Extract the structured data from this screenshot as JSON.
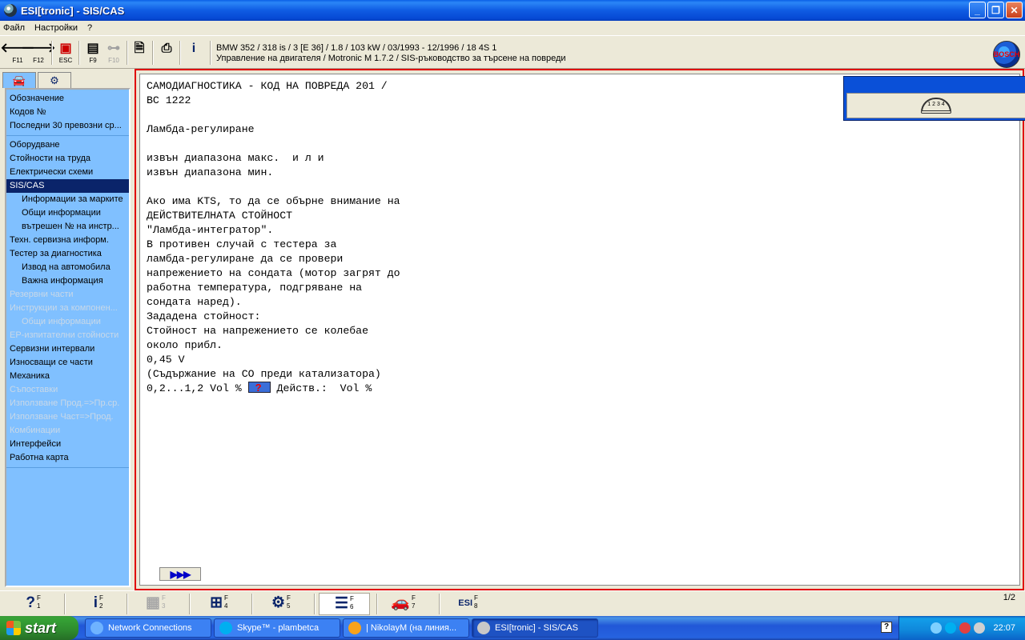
{
  "window": {
    "title": "ESI[tronic] - SIS/CAS",
    "buttons": {
      "minimize": "_",
      "maximize": "❐",
      "close": "✕"
    }
  },
  "menu": [
    "Файл",
    "Настройки",
    "?"
  ],
  "toolbar": {
    "back_key": "F11",
    "forward_key": "F12",
    "esc_key": "ESC",
    "f9_key": "F9",
    "f10_key": "F10",
    "vehicle_line1": "BMW 352 / 318 is / 3 [E 36] / 1.8 / 103 kW / 03/1993 - 12/1996 / 18 4S 1",
    "vehicle_line2": "Управление на двигателя / Motronic M 1.7.2 / SIS-ръководство за търсене на повреди",
    "logo_text": "BOSCH"
  },
  "sidebar": {
    "groups": [
      {
        "items": [
          {
            "label": "Обозначение",
            "state": "normal"
          },
          {
            "label": "Кодов №",
            "state": "normal"
          },
          {
            "label": "Последни 30 превозни ср...",
            "state": "normal"
          }
        ]
      },
      {
        "items": [
          {
            "label": "Оборудване",
            "state": "normal"
          },
          {
            "label": "Стойности на труда",
            "state": "normal"
          },
          {
            "label": "Електрически схеми",
            "state": "normal"
          },
          {
            "label": "SIS/CAS",
            "state": "active"
          },
          {
            "label": "Информации за марките",
            "state": "sub"
          },
          {
            "label": "Общи информации",
            "state": "sub"
          },
          {
            "label": "вътрешен № на инстр...",
            "state": "sub"
          },
          {
            "label": "Техн. сервизна информ.",
            "state": "normal"
          },
          {
            "label": "Тестер за диагностика",
            "state": "normal"
          },
          {
            "label": "Извод на автомобила",
            "state": "sub"
          },
          {
            "label": "Важна информация",
            "state": "sub"
          },
          {
            "label": "Резервни части",
            "state": "disabled"
          },
          {
            "label": "Инструкции за компонен...",
            "state": "disabled"
          },
          {
            "label": "Общи информации",
            "state": "sub-disabled"
          },
          {
            "label": "ЕР-изпитателни стойности",
            "state": "disabled"
          },
          {
            "label": "Сервизни интервали",
            "state": "normal"
          },
          {
            "label": "Износващи се части",
            "state": "normal"
          },
          {
            "label": "Механика",
            "state": "normal"
          },
          {
            "label": "Съпоставки",
            "state": "disabled"
          },
          {
            "label": "Използване Прод.=>Пр.ср.",
            "state": "disabled"
          },
          {
            "label": "Използване Част=>Прод.",
            "state": "disabled"
          },
          {
            "label": "Комбинации",
            "state": "disabled"
          },
          {
            "label": "Интерфейси",
            "state": "normal"
          },
          {
            "label": "Работна карта",
            "state": "normal"
          }
        ]
      }
    ]
  },
  "content": {
    "lines": [
      "САМОДИАГНОСТИКА - КОД НА ПОВРЕДА 201 /",
      "BC 1222",
      "",
      "Ламбда-регулиране",
      "",
      "извън диапазона макс.  и л и",
      "извън диапазона мин.",
      "",
      "Ако има KTS, то да се обърне внимание на",
      "ДЕЙСТВИТЕЛНАТА СТОЙНОСТ",
      "\"Ламбда-интегратор\".",
      "В противен случай с тестера за",
      "ламбда-регулиране да се провери",
      "напрежението на сондата (мотор загрят до",
      "работна температура, подгряване на",
      "сондата наред).",
      "Зададена стойност:",
      "Стойност на напрежението се колебае",
      "около прибл.",
      "0,45 V",
      "(Съдържание на CO преди катализатора)"
    ],
    "last_line_prefix": "0,2...1,2 Vol % ",
    "last_line_q": "?",
    "last_line_suffix": " Действ.:  Vol %",
    "next_button": "▶▶▶",
    "meter_label": "1 2 3 4"
  },
  "fkeys": [
    {
      "glyph": "?",
      "num": "F\n1",
      "state": "normal"
    },
    {
      "glyph": "i",
      "num": "F\n2",
      "state": "normal"
    },
    {
      "glyph": "▦",
      "num": "F\n3",
      "state": "disabled"
    },
    {
      "glyph": "⊞",
      "num": "F\n4",
      "state": "normal"
    },
    {
      "glyph": "⚙",
      "num": "F\n5",
      "state": "normal"
    },
    {
      "glyph": "☰",
      "num": "F\n6",
      "state": "active"
    },
    {
      "glyph": "🚗",
      "num": "F\n7",
      "state": "normal"
    },
    {
      "glyph": "ESI",
      "num": "F\n8",
      "state": "normal"
    }
  ],
  "page_indicator": "1/2",
  "taskbar": {
    "start": "start",
    "tasks": [
      {
        "label": "Network Connections",
        "color": "#6fb3ff",
        "active": false
      },
      {
        "label": "Skype™ - plambetca",
        "color": "#00aff0",
        "active": false
      },
      {
        "label": "| NikolayM (на линия...",
        "color": "#f8a21a",
        "active": false
      },
      {
        "label": "ESI[tronic] - SIS/CAS",
        "color": "#c8c8c8",
        "active": true
      }
    ],
    "help": "?",
    "clock": "22:07"
  }
}
